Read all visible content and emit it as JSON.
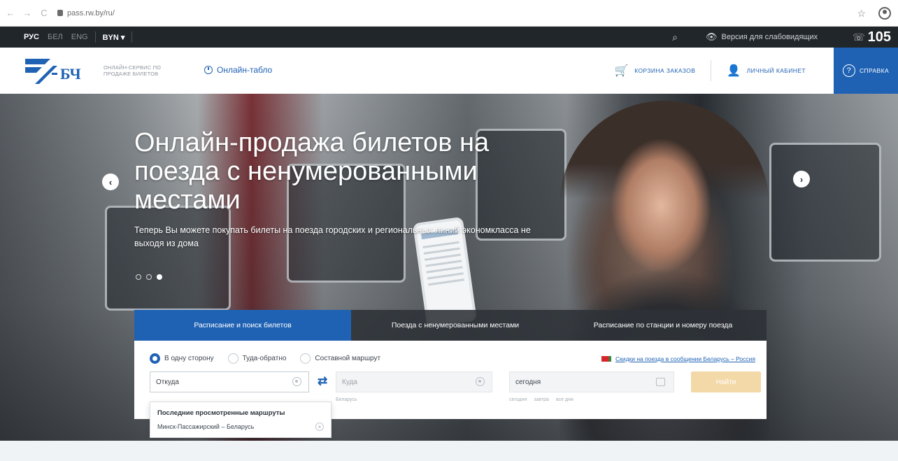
{
  "browser": {
    "url": "pass.rw.by/ru/",
    "back_glyph": "←",
    "forward_glyph": "→",
    "reload_glyph": "C",
    "star_glyph": "☆"
  },
  "topbar": {
    "languages": [
      "РУС",
      "БЕЛ",
      "ENG"
    ],
    "currency": "BYN ▾",
    "search_glyph": "⌕",
    "vision_label": "Версия для слабовидящих",
    "vision_glyph": "👁",
    "phone_glyph": "☏",
    "phone_number": "105"
  },
  "header": {
    "logo_letters": "БЧ",
    "logo_caption_line1": "ОНЛАЙН-СЕРВИС ПО",
    "logo_caption_line2": "ПРОДАЖЕ БИЛЕТОВ",
    "tablo_label": "Онлайн-табло",
    "cart_glyph": "🛒",
    "cart_label": "КОРЗИНА ЗАКАЗОВ",
    "account_glyph": "👤",
    "account_label": "ЛИЧНЫЙ КАБИНЕТ",
    "help_label": "СПРАВКА",
    "help_glyph": "?"
  },
  "hero": {
    "title": "Онлайн-продажа билетов на поезда с ненумерованными местами",
    "subtitle": "Теперь Вы можете покупать билеты на поезда городских и региональных линий экономкласса не выходя из дома",
    "prev_glyph": "‹",
    "next_glyph": "›",
    "slide_count": 3,
    "active_slide": 3
  },
  "search": {
    "tabs": [
      "Расписание и поиск билетов",
      "Поезда с ненумерованными местами",
      "Расписание по станции и номеру поезда"
    ],
    "active_tab": 0,
    "trip_types": [
      "В одну сторону",
      "Туда-обратно",
      "Составной маршрут"
    ],
    "selected_trip_type": 0,
    "promo_link": "Скидки на поезда в сообщении Беларусь – Россия",
    "from_placeholder": "Откуда",
    "to_placeholder": "Куда",
    "to_hint": "Беларусь",
    "swap_glyph": "⇄",
    "date_value": "сегодня",
    "date_hints": [
      "сегодня",
      "завтра",
      "все дни"
    ],
    "find_label": "Найти"
  },
  "recent_routes": {
    "title": "Последние просмотренные маршруты",
    "items": [
      "Минск-Пассажирский – Беларусь"
    ],
    "remove_glyph": "×"
  },
  "colors": {
    "brand_blue": "#1f62b4",
    "topbar_dark": "#21262b",
    "find_button_disabled": "#f3d9a8"
  }
}
